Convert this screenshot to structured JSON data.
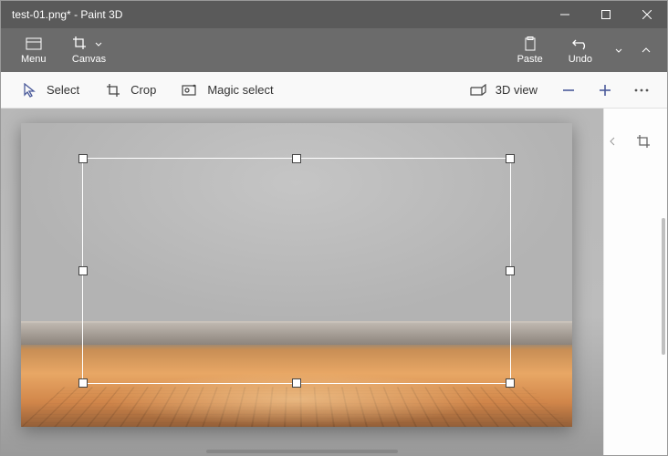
{
  "titlebar": {
    "filename": "test-01.png*",
    "app": "Paint 3D"
  },
  "ribbon": {
    "menu": "Menu",
    "canvas": "Canvas",
    "paste": "Paste",
    "undo": "Undo"
  },
  "toolbar": {
    "select": "Select",
    "crop": "Crop",
    "magic_select": "Magic select",
    "view3d": "3D view"
  },
  "icons": {
    "minimize": "minimize",
    "maximize": "maximize",
    "close": "close",
    "menu": "hamburger-icon",
    "crop_canvas": "crop-icon",
    "clipboard": "clipboard-icon",
    "undo": "undo-icon",
    "pointer": "pointer-icon",
    "crop": "crop-icon",
    "magic": "magic-select-icon",
    "box3d": "3d-box-icon",
    "zoom_out": "minus-icon",
    "zoom_in": "plus-icon",
    "more": "more-icon"
  }
}
